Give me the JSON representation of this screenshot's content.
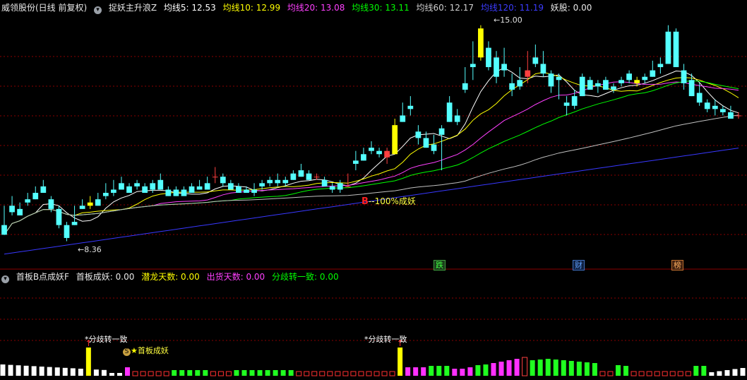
{
  "main_header": {
    "stock": "威领股份(日线 前复权)",
    "indicator": "捉妖主升浪Z",
    "ma5": "均线5: 12.53",
    "ma10": "均线10: 12.99",
    "ma20": "均线20: 13.08",
    "ma30": "均线30: 13.11",
    "ma60": "均线60: 12.17",
    "ma120": "均线120: 11.19",
    "yao": "妖股: 0.00"
  },
  "sub_header": {
    "indicator": "首板B点成妖F",
    "sbcy": "首板成妖: 0.00",
    "qianlong": "潜龙天数: 0.00",
    "chuhuo": "出货天数: 0.00",
    "fenqi": "分歧转一致: 0.00"
  },
  "annotations": {
    "high_price": "15.00",
    "low_price": "8.36",
    "b_signal": "B",
    "b_text": "--100%成妖",
    "fenqi1": "*分歧转一致",
    "fenqi2": "*分歧转一致",
    "shouban": "首板成妖",
    "s_badge": "S"
  },
  "tags": {
    "die": "跌",
    "cai": "财",
    "bang": "榜"
  },
  "colors": {
    "up": "#ff4040",
    "down": "#54ffff",
    "ma5": "#ffffff",
    "ma10": "#ffff00",
    "ma20": "#ff40ff",
    "ma30": "#00ff00",
    "ma60": "#c0c0c0",
    "ma120": "#3838ff",
    "grid": "#8a0000",
    "yellow_bar": "#ffff00"
  },
  "chart_data": {
    "type": "candlestick",
    "ylim": [
      7.6,
      15.4
    ],
    "candles": [
      [
        8.9,
        9.5,
        8.6,
        8.6
      ],
      [
        9.5,
        9.8,
        9.2,
        9.3
      ],
      [
        9.4,
        9.6,
        9.2,
        9.2
      ],
      [
        9.7,
        9.9,
        9.5,
        9.6
      ],
      [
        9.9,
        10.1,
        9.7,
        9.7
      ],
      [
        10.1,
        10.3,
        9.9,
        9.9
      ],
      [
        9.7,
        9.8,
        9.3,
        9.4
      ],
      [
        9.4,
        9.5,
        8.8,
        8.9
      ],
      [
        8.9,
        9.0,
        8.4,
        8.5
      ],
      [
        9.0,
        9.5,
        8.9,
        8.9
      ],
      [
        9.5,
        9.7,
        9.4,
        9.4
      ],
      [
        9.6,
        9.8,
        9.4,
        9.5
      ],
      [
        9.7,
        9.9,
        9.5,
        9.5
      ],
      [
        9.9,
        10.2,
        9.7,
        9.8
      ],
      [
        10.0,
        10.3,
        9.8,
        9.9
      ],
      [
        10.2,
        10.4,
        10.0,
        10.0
      ],
      [
        10.1,
        10.2,
        9.9,
        9.9
      ],
      [
        10.2,
        10.3,
        10.0,
        10.1
      ],
      [
        10.1,
        10.2,
        9.9,
        9.9
      ],
      [
        10.2,
        10.3,
        9.9,
        10.0
      ],
      [
        10.3,
        10.5,
        10.0,
        10.0
      ],
      [
        10.0,
        10.1,
        9.8,
        9.8
      ],
      [
        10.0,
        10.1,
        9.8,
        9.8
      ],
      [
        10.0,
        10.1,
        9.8,
        9.8
      ],
      [
        10.1,
        10.2,
        9.9,
        9.9
      ],
      [
        10.1,
        10.3,
        10.0,
        10.0
      ],
      [
        10.2,
        10.4,
        10.0,
        10.0
      ],
      [
        10.4,
        10.7,
        10.2,
        10.4
      ],
      [
        10.4,
        10.5,
        10.1,
        10.2
      ],
      [
        10.2,
        10.3,
        10.0,
        10.0
      ],
      [
        10.1,
        10.2,
        9.9,
        9.9
      ],
      [
        10.0,
        10.1,
        9.9,
        9.9
      ],
      [
        10.0,
        10.2,
        9.8,
        9.9
      ],
      [
        10.2,
        10.3,
        10.0,
        10.1
      ],
      [
        10.3,
        10.4,
        10.1,
        10.2
      ],
      [
        10.3,
        10.5,
        10.1,
        10.2
      ],
      [
        10.3,
        10.4,
        10.1,
        10.2
      ],
      [
        10.5,
        10.6,
        10.3,
        10.3
      ],
      [
        10.6,
        10.8,
        10.4,
        10.4
      ],
      [
        10.5,
        10.6,
        10.3,
        10.3
      ],
      [
        10.4,
        10.5,
        10.3,
        10.4
      ],
      [
        10.3,
        10.4,
        10.1,
        10.1
      ],
      [
        10.1,
        10.2,
        9.9,
        10.0
      ],
      [
        10.2,
        10.3,
        9.9,
        10.0
      ],
      [
        10.1,
        10.5,
        10.1,
        10.1
      ],
      [
        10.9,
        11.2,
        10.6,
        10.8
      ],
      [
        11.1,
        11.3,
        10.9,
        10.9
      ],
      [
        11.3,
        11.5,
        11.1,
        11.2
      ],
      [
        11.2,
        11.3,
        11.0,
        11.1
      ],
      [
        11.0,
        11.3,
        10.8,
        11.2
      ],
      [
        12.0,
        12.2,
        11.1,
        11.1
      ],
      [
        12.3,
        12.7,
        12.1,
        12.1
      ],
      [
        12.6,
        12.9,
        12.3,
        12.5
      ],
      [
        11.8,
        12.0,
        11.4,
        11.6
      ],
      [
        11.6,
        11.8,
        11.3,
        11.3
      ],
      [
        11.4,
        11.7,
        11.1,
        11.2
      ],
      [
        11.9,
        12.0,
        10.6,
        11.7
      ],
      [
        12.7,
        12.9,
        12.1,
        12.1
      ],
      [
        12.3,
        12.5,
        12.0,
        12.1
      ],
      [
        13.3,
        13.8,
        13.0,
        13.1
      ],
      [
        13.9,
        14.6,
        13.4,
        13.8
      ],
      [
        15.0,
        15.1,
        14.0,
        14.1
      ],
      [
        14.4,
        14.6,
        13.7,
        13.8
      ],
      [
        14.1,
        14.3,
        13.3,
        13.5
      ],
      [
        13.9,
        14.4,
        13.5,
        13.7
      ],
      [
        13.3,
        13.6,
        12.9,
        13.1
      ],
      [
        13.4,
        13.8,
        13.1,
        13.2
      ],
      [
        13.5,
        14.3,
        13.3,
        13.7
      ],
      [
        14.1,
        14.5,
        13.8,
        13.9
      ],
      [
        13.9,
        14.3,
        13.5,
        13.6
      ],
      [
        13.6,
        13.7,
        13.0,
        13.2
      ],
      [
        13.5,
        13.6,
        12.8,
        13.4
      ],
      [
        12.7,
        12.9,
        12.3,
        12.6
      ],
      [
        12.9,
        13.1,
        12.5,
        12.6
      ],
      [
        13.5,
        13.6,
        12.9,
        12.9
      ],
      [
        13.4,
        13.5,
        13.1,
        13.1
      ],
      [
        13.3,
        13.4,
        13.0,
        13.2
      ],
      [
        13.4,
        13.5,
        13.1,
        13.1
      ],
      [
        13.2,
        13.3,
        13.0,
        13.1
      ],
      [
        13.4,
        13.5,
        13.2,
        13.3
      ],
      [
        13.6,
        13.7,
        13.3,
        13.4
      ],
      [
        13.4,
        13.5,
        13.2,
        13.3
      ],
      [
        13.5,
        13.6,
        13.3,
        13.4
      ],
      [
        13.7,
        14.0,
        13.5,
        13.5
      ],
      [
        13.9,
        14.1,
        13.6,
        13.8
      ],
      [
        14.9,
        15.1,
        13.9,
        13.9
      ],
      [
        14.9,
        15.0,
        13.8,
        13.8
      ],
      [
        13.7,
        13.9,
        13.1,
        13.3
      ],
      [
        13.4,
        13.6,
        12.9,
        12.9
      ],
      [
        13.0,
        13.3,
        12.6,
        12.7
      ],
      [
        12.7,
        12.8,
        12.4,
        12.5
      ],
      [
        12.6,
        12.8,
        12.3,
        12.5
      ],
      [
        12.5,
        12.6,
        12.3,
        12.4
      ],
      [
        12.4,
        12.6,
        12.2,
        12.2
      ],
      [
        12.3,
        12.4,
        12.2,
        12.3
      ]
    ],
    "sub_bars": [
      "w",
      "w",
      "w",
      "w",
      "w",
      "w",
      "w",
      "w",
      "w",
      "w",
      "w",
      "y",
      "w",
      "w",
      "x",
      "x",
      "m",
      "r",
      "r",
      "r",
      "r",
      "r",
      "g",
      "g",
      "g",
      "g",
      "g",
      "r",
      "r",
      "r",
      "g",
      "g",
      "g",
      "g",
      "g",
      "g",
      "g",
      "g",
      "r",
      "r",
      "r",
      "r",
      "r",
      "r",
      "r",
      "r",
      "r",
      "r",
      "r",
      "r",
      "r",
      "y",
      "m",
      "m",
      "m",
      "g",
      "g",
      "g",
      "m",
      "m",
      "m",
      "g",
      "g",
      "m",
      "m",
      "m",
      "m",
      "M",
      "g",
      "g",
      "g",
      "g",
      "g",
      "g",
      "g",
      "g",
      "g",
      "r",
      "r",
      "g",
      "g",
      "r",
      "r",
      "r",
      "r",
      "r",
      "r",
      "r",
      "r",
      "g",
      "g",
      "w",
      "w",
      "w",
      "w",
      "w"
    ]
  }
}
